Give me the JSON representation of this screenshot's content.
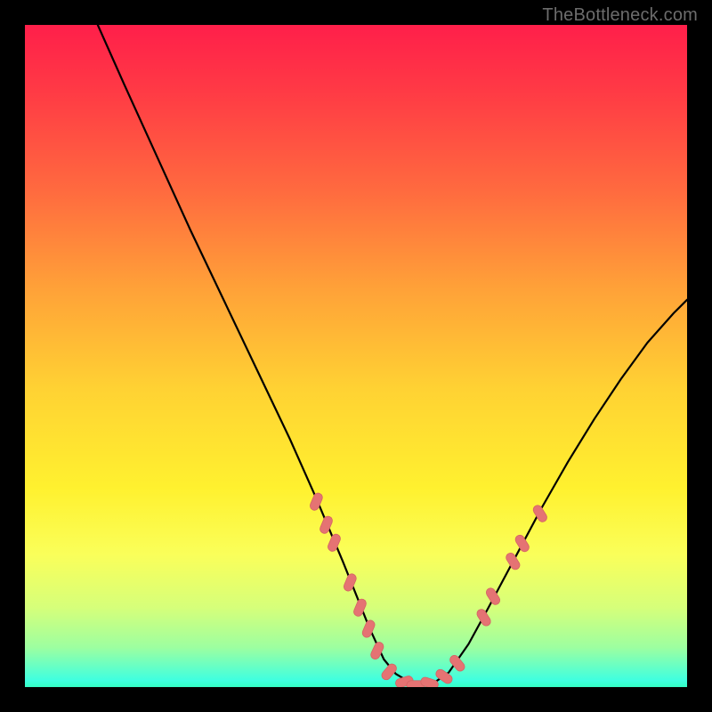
{
  "watermark": {
    "text": "TheBottleneck.com"
  },
  "colors": {
    "curve": "#000000",
    "marker_fill": "#e57373",
    "marker_stroke": "#d46464",
    "frame": "#000000"
  },
  "chart_data": {
    "type": "line",
    "title": "",
    "xlabel": "",
    "ylabel": "",
    "xlim": [
      0,
      100
    ],
    "ylim": [
      0,
      100
    ],
    "grid": false,
    "legend": false,
    "annotations": [],
    "series": [
      {
        "name": "curve",
        "x": [
          11.0,
          15.0,
          20.0,
          25.0,
          30.0,
          35.0,
          40.0,
          44.0,
          48.0,
          50.0,
          52.0,
          54.2,
          56.0,
          58.0,
          60.0,
          62.0,
          64.0,
          67.0,
          70.0,
          74.0,
          78.0,
          82.0,
          86.0,
          90.0,
          94.0,
          98.0,
          100.0
        ],
        "y": [
          100.0,
          91.0,
          80.0,
          69.0,
          58.5,
          48.0,
          37.5,
          28.5,
          19.0,
          14.0,
          9.0,
          4.2,
          2.0,
          0.8,
          0.3,
          0.8,
          2.2,
          6.5,
          12.0,
          19.5,
          27.0,
          34.0,
          40.5,
          46.5,
          52.0,
          56.5,
          58.5
        ]
      }
    ],
    "markers": [
      {
        "x": 44.0,
        "y": 28.0,
        "rot": -67
      },
      {
        "x": 45.5,
        "y": 24.5,
        "rot": -67
      },
      {
        "x": 46.7,
        "y": 21.8,
        "rot": -67
      },
      {
        "x": 49.1,
        "y": 15.8,
        "rot": -67
      },
      {
        "x": 50.6,
        "y": 12.0,
        "rot": -67
      },
      {
        "x": 51.9,
        "y": 8.8,
        "rot": -67
      },
      {
        "x": 53.2,
        "y": 5.5,
        "rot": -65
      },
      {
        "x": 55.0,
        "y": 2.3,
        "rot": -50
      },
      {
        "x": 57.3,
        "y": 0.8,
        "rot": -17
      },
      {
        "x": 59.0,
        "y": 0.3,
        "rot": 0
      },
      {
        "x": 61.1,
        "y": 0.6,
        "rot": 18
      },
      {
        "x": 63.3,
        "y": 1.6,
        "rot": 35
      },
      {
        "x": 65.3,
        "y": 3.6,
        "rot": 50
      },
      {
        "x": 69.3,
        "y": 10.5,
        "rot": 58
      },
      {
        "x": 70.7,
        "y": 13.7,
        "rot": 58
      },
      {
        "x": 73.7,
        "y": 19.0,
        "rot": 58
      },
      {
        "x": 75.1,
        "y": 21.7,
        "rot": 58
      },
      {
        "x": 77.8,
        "y": 26.2,
        "rot": 58
      }
    ]
  }
}
